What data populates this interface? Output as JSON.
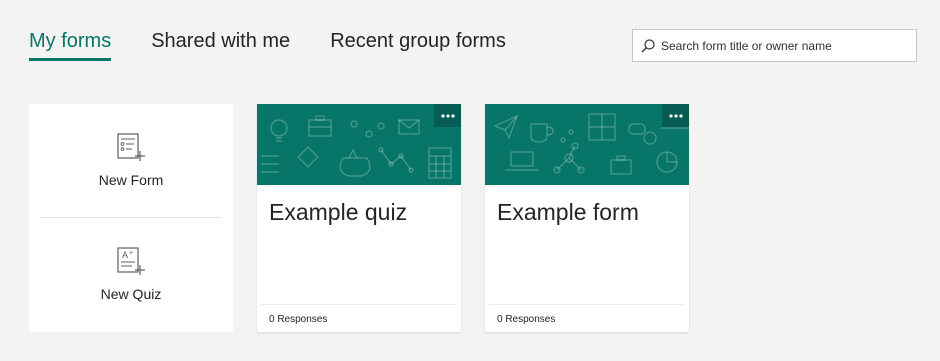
{
  "tabs": [
    {
      "label": "My forms",
      "active": true
    },
    {
      "label": "Shared with me",
      "active": false
    },
    {
      "label": "Recent group forms",
      "active": false
    }
  ],
  "search": {
    "placeholder": "Search form title or owner name",
    "icon": "search-icon"
  },
  "new_panel": {
    "new_form_label": "New Form",
    "new_form_icon": "new-form-icon",
    "new_quiz_label": "New Quiz",
    "new_quiz_icon": "new-quiz-icon"
  },
  "cards": [
    {
      "title": "Example quiz",
      "responses": "0 Responses",
      "more_icon": "more-options-icon"
    },
    {
      "title": "Example form",
      "responses": "0 Responses",
      "more_icon": "more-options-icon"
    }
  ],
  "colors": {
    "accent": "#077568",
    "banner_dark": "#055c52",
    "background": "#f3f3f3"
  }
}
